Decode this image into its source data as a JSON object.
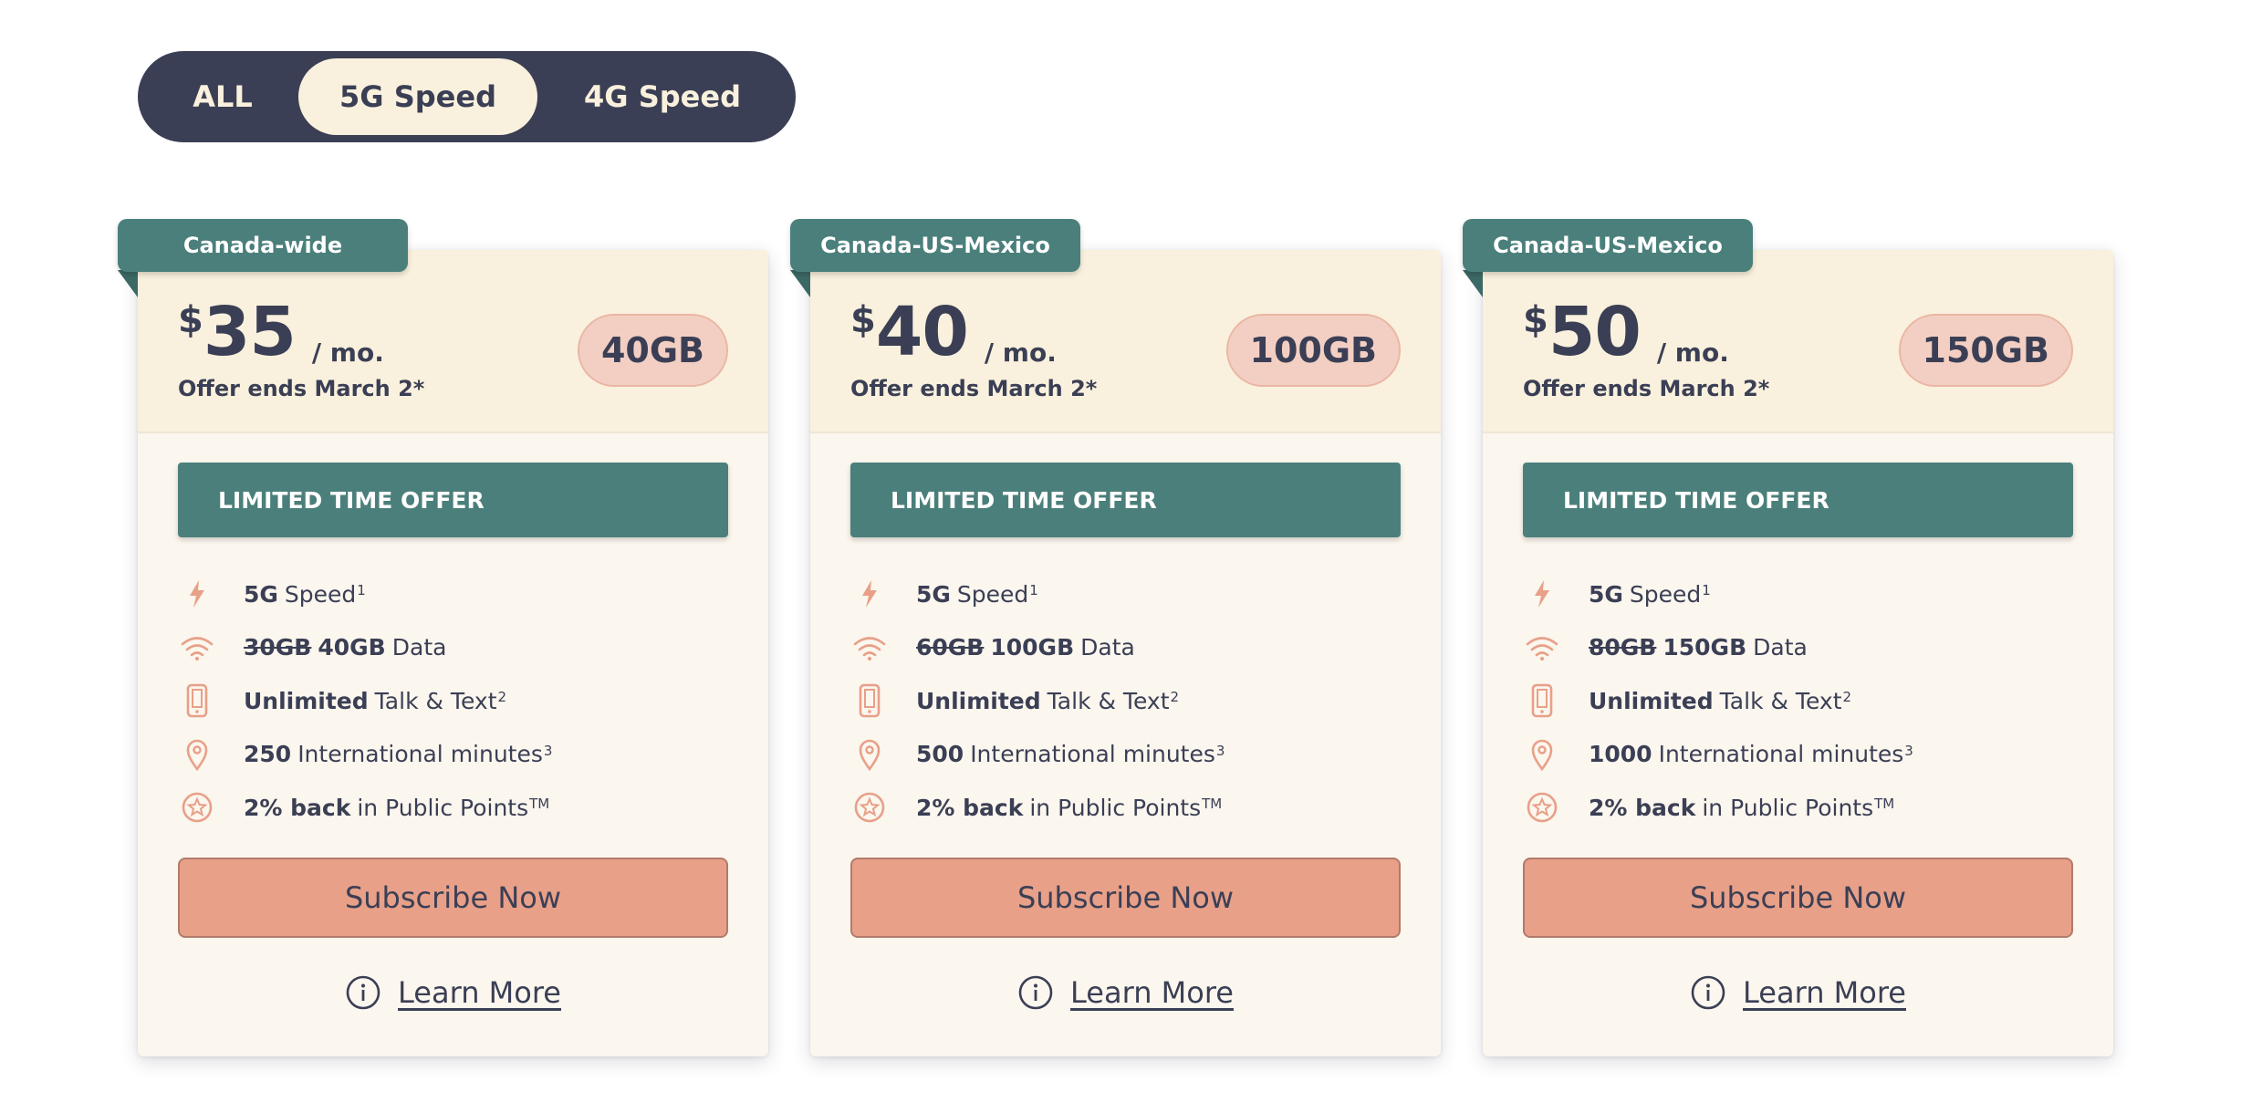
{
  "filter": {
    "options": [
      "ALL",
      "5G Speed",
      "4G Speed"
    ],
    "selected": "5G Speed"
  },
  "colors": {
    "navy": "#3b3f55",
    "cream": "#f9f1dd",
    "teal": "#4b7f7b",
    "salmon": "#e8a088",
    "badge": "#f3cfc3",
    "icon": "#e8a088"
  },
  "plans": [
    {
      "region": "Canada-wide",
      "currency": "$",
      "price": "35",
      "per": "/ mo.",
      "offer_ends": "Offer ends March 2*",
      "data_badge": "40GB",
      "offer_banner": "LIMITED TIME OFFER",
      "features": {
        "speed_bold": "5G",
        "speed_text": "Speed",
        "speed_sup": "1",
        "data_old": "30GB",
        "data_new": "40GB",
        "data_text": "Data",
        "talk_bold": "Unlimited",
        "talk_text": "Talk & Text",
        "talk_sup": "2",
        "intl_bold": "250",
        "intl_text": "International minutes",
        "intl_sup": "3",
        "points_bold": "2% back",
        "points_text": "in Public Points",
        "points_sup": "TM"
      },
      "subscribe_label": "Subscribe Now",
      "learn_label": "Learn More"
    },
    {
      "region": "Canada-US-Mexico",
      "currency": "$",
      "price": "40",
      "per": "/ mo.",
      "offer_ends": "Offer ends March 2*",
      "data_badge": "100GB",
      "offer_banner": "LIMITED TIME OFFER",
      "features": {
        "speed_bold": "5G",
        "speed_text": "Speed",
        "speed_sup": "1",
        "data_old": "60GB",
        "data_new": "100GB",
        "data_text": "Data",
        "talk_bold": "Unlimited",
        "talk_text": "Talk & Text",
        "talk_sup": "2",
        "intl_bold": "500",
        "intl_text": "International minutes",
        "intl_sup": "3",
        "points_bold": "2% back",
        "points_text": "in Public Points",
        "points_sup": "TM"
      },
      "subscribe_label": "Subscribe Now",
      "learn_label": "Learn More"
    },
    {
      "region": "Canada-US-Mexico",
      "currency": "$",
      "price": "50",
      "per": "/ mo.",
      "offer_ends": "Offer ends March 2*",
      "data_badge": "150GB",
      "offer_banner": "LIMITED TIME OFFER",
      "features": {
        "speed_bold": "5G",
        "speed_text": "Speed",
        "speed_sup": "1",
        "data_old": "80GB",
        "data_new": "150GB",
        "data_text": "Data",
        "talk_bold": "Unlimited",
        "talk_text": "Talk & Text",
        "talk_sup": "2",
        "intl_bold": "1000",
        "intl_text": "International minutes",
        "intl_sup": "3",
        "points_bold": "2% back",
        "points_text": "in Public Points",
        "points_sup": "TM"
      },
      "subscribe_label": "Subscribe Now",
      "learn_label": "Learn More"
    }
  ]
}
